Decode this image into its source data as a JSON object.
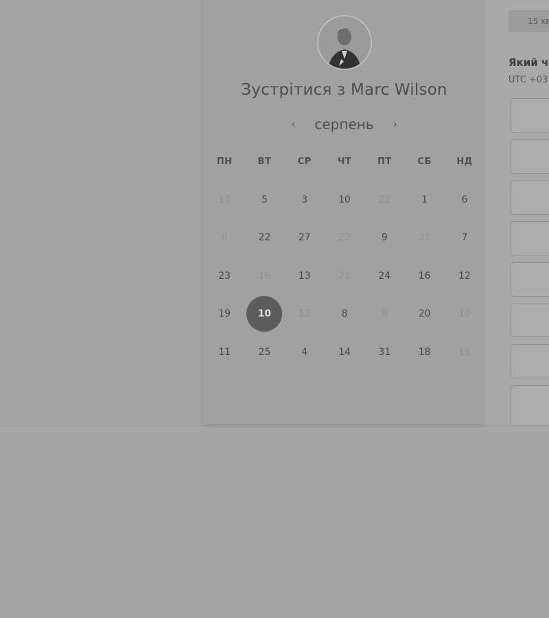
{
  "host": {
    "title": "Зустрітися з Marc Wilson",
    "avatar_icon": "avatar-photo"
  },
  "calendar": {
    "month": "серпень",
    "prev_icon": "‹",
    "next_icon": "›",
    "weekdays": [
      "ПН",
      "ВТ",
      "СР",
      "ЧТ",
      "ПТ",
      "СБ",
      "НД"
    ],
    "weeks": [
      [
        {
          "d": "13",
          "m": true
        },
        {
          "d": "5"
        },
        {
          "d": "3"
        },
        {
          "d": "10"
        },
        {
          "d": "22",
          "m": true
        },
        {
          "d": "1"
        },
        {
          "d": "6"
        }
      ],
      [
        {
          "d": "8",
          "m": true
        },
        {
          "d": "22"
        },
        {
          "d": "27"
        },
        {
          "d": "22",
          "m": true
        },
        {
          "d": "9"
        },
        {
          "d": "31",
          "m": true
        },
        {
          "d": "7"
        }
      ],
      [
        {
          "d": "23"
        },
        {
          "d": "16",
          "m": true
        },
        {
          "d": "13"
        },
        {
          "d": "21",
          "m": true
        },
        {
          "d": "24"
        },
        {
          "d": "16"
        },
        {
          "d": "12"
        }
      ],
      [
        {
          "d": "19"
        },
        {
          "d": "10",
          "s": true
        },
        {
          "d": "12",
          "m": true
        },
        {
          "d": "8"
        },
        {
          "d": "9",
          "m": true
        },
        {
          "d": "20"
        },
        {
          "d": "10",
          "m": true
        }
      ],
      [
        {
          "d": "11"
        },
        {
          "d": "25"
        },
        {
          "d": "4"
        },
        {
          "d": "14"
        },
        {
          "d": "31"
        },
        {
          "d": "18"
        },
        {
          "d": "11",
          "m": true
        }
      ]
    ],
    "selected_day": "10"
  },
  "booking": {
    "duration_tab": "15 хв",
    "question": "Який ча",
    "timezone": "UTC +03"
  },
  "colors": {
    "selected_bg": "#5c5c5c"
  }
}
